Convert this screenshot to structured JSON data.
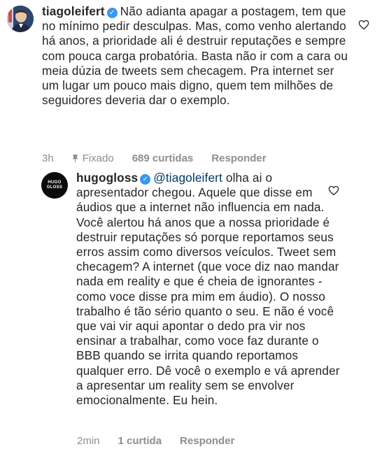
{
  "comment": {
    "username": "tiagoleifert",
    "text": "Não adianta apagar a postagem, tem que no mínimo pedir desculpas. Mas, como venho alertando há anos, a prioridade ali é destruir reputações e sempre com pouca carga probatória. Basta não ir com a cara ou meia dúzia de tweets sem checagem. Pra internet ser um lugar um pouco mais digno, quem tem milhões de seguidores deveria dar o exemplo.",
    "time": "3h",
    "pinned": "Fixado",
    "likes": "689 curtidas",
    "reply_label": "Responder"
  },
  "reply": {
    "username": "hugogloss",
    "mention": "@tiagoleifert",
    "text": " olha ai o apresentador chegou. Aquele que disse em áudios que a internet não influencia em nada. Você alertou há anos que a nossa prioridade é destruir reputações só porque reportamos seus erros assim como diversos veículos. Tweet sem checagem? A internet (que voce diz nao mandar nada em reality e que é cheia de ignorantes - como voce disse pra mim em áudio). O nosso trabalho é tão sério quanto o seu. E não é você que vai vir aqui apontar o dedo pra vir nos ensinar a trabalhar, como voce faz durante o BBB quando se irrita quando reportamos qualquer erro. Dê você o exemplo e vá aprender a apresentar um reality sem se envolver emocionalmente. Eu hein.",
    "avatar_text_top": "HUGO",
    "avatar_text_bottom": "GLOSS",
    "time": "2min",
    "likes": "1 curtida",
    "reply_label": "Responder"
  },
  "icons": {
    "verified": "verified-badge-icon",
    "heart": "heart-outline-icon",
    "pin": "pin-icon"
  },
  "colors": {
    "verified": "#3897f0",
    "meta": "#8e8e8e",
    "mention": "#00376b"
  }
}
